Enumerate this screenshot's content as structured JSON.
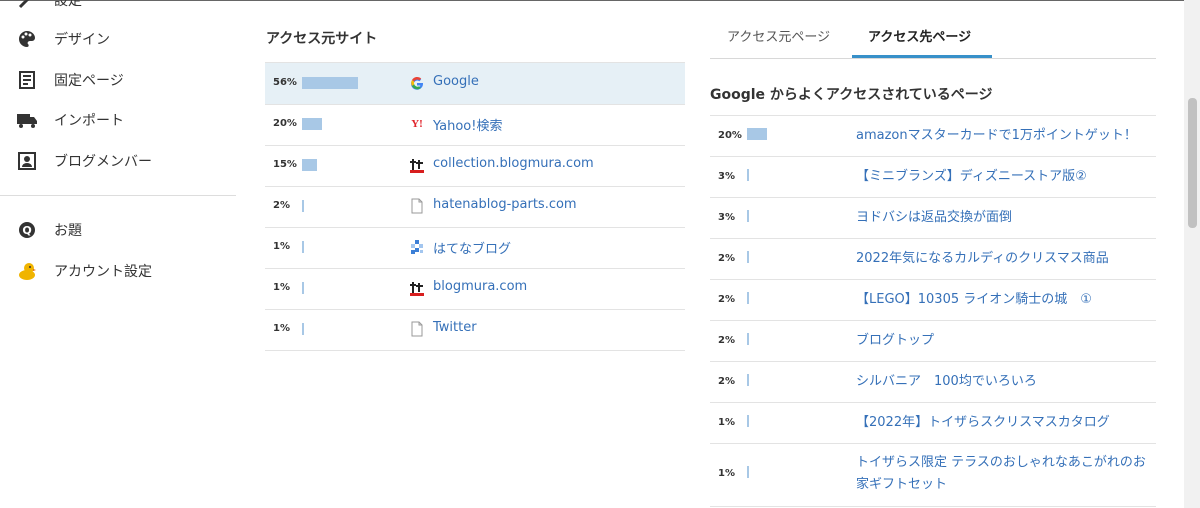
{
  "sidebar": {
    "items": [
      {
        "label": "設定",
        "icon": "wrench-icon"
      },
      {
        "label": "デザイン",
        "icon": "palette-icon"
      },
      {
        "label": "固定ページ",
        "icon": "document-icon"
      },
      {
        "label": "インポート",
        "icon": "truck-icon"
      },
      {
        "label": "ブログメンバー",
        "icon": "member-card-icon"
      },
      {
        "label": "お題",
        "icon": "question-badge-icon"
      },
      {
        "label": "アカウント設定",
        "icon": "chick-avatar-icon"
      }
    ]
  },
  "sites": {
    "title": "アクセス元サイト",
    "rows": [
      {
        "pct": "56%",
        "value": 56,
        "name": "Google",
        "icon": "google-icon"
      },
      {
        "pct": "20%",
        "value": 20,
        "name": "Yahoo!検索",
        "icon": "yahoo-icon"
      },
      {
        "pct": "15%",
        "value": 15,
        "name": "collection.blogmura.com",
        "icon": "blogmura-icon"
      },
      {
        "pct": "2%",
        "value": 2,
        "name": "hatenablog-parts.com",
        "icon": "page-icon"
      },
      {
        "pct": "1%",
        "value": 1,
        "name": "はてなブログ",
        "icon": "hatena-blog-icon"
      },
      {
        "pct": "1%",
        "value": 1,
        "name": "blogmura.com",
        "icon": "blogmura-icon"
      },
      {
        "pct": "1%",
        "value": 1,
        "name": "Twitter",
        "icon": "page-icon"
      }
    ]
  },
  "tabs": {
    "source": "アクセス元ページ",
    "dest": "アクセス先ページ"
  },
  "pages": {
    "title": "Google からよくアクセスされているページ",
    "rows": [
      {
        "pct": "20%",
        "value": 20,
        "name": "amazonマスターカードで1万ポイントゲット！"
      },
      {
        "pct": "3%",
        "value": 3,
        "name": "【ミニブランズ】ディズニーストア版②"
      },
      {
        "pct": "3%",
        "value": 3,
        "name": "ヨドバシは返品交換が面倒"
      },
      {
        "pct": "2%",
        "value": 2,
        "name": "2022年気になるカルディのクリスマス商品"
      },
      {
        "pct": "2%",
        "value": 2,
        "name": "【LEGO】10305 ライオン騎士の城　①"
      },
      {
        "pct": "2%",
        "value": 2,
        "name": "ブログトップ"
      },
      {
        "pct": "2%",
        "value": 2,
        "name": "シルバニア　100均でいろいろ"
      },
      {
        "pct": "1%",
        "value": 1,
        "name": "【2022年】トイザらスクリスマスカタログ"
      },
      {
        "pct": "1%",
        "value": 1,
        "name": "トイザらス限定 テラスのおしゃれなあこがれのお家ギフトセット"
      }
    ]
  },
  "colors": {
    "bar": "#a8c8e6",
    "link": "#3570b8",
    "highlight": "#e6f0f6",
    "tab_accent": "#3790c9"
  }
}
